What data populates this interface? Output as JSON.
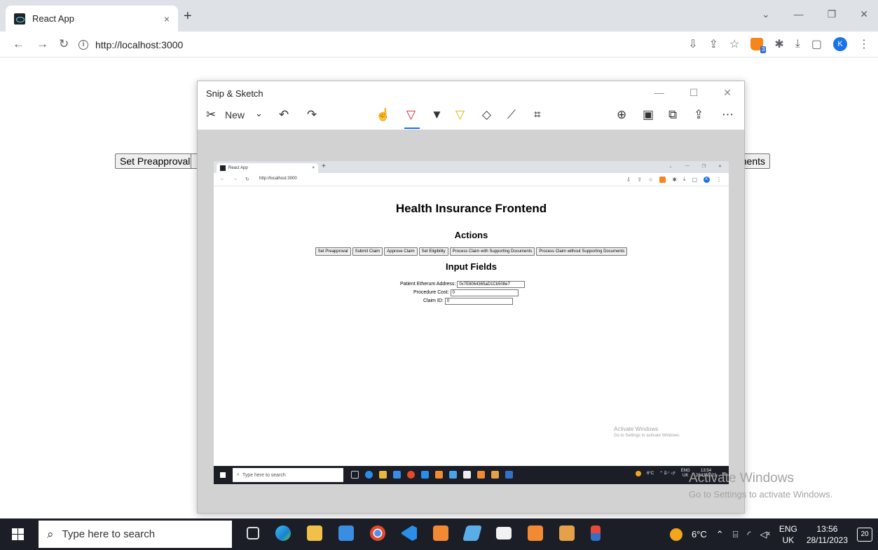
{
  "browser": {
    "tab_title": "React App",
    "tab_close": "×",
    "new_tab": "+",
    "url": "http://localhost:3000",
    "profile_initial": "K",
    "extension_badge": "3"
  },
  "outer_page": {
    "left_button": "Set Preapproval",
    "right_button_fragment": "nents"
  },
  "snip": {
    "title": "Snip & Sketch",
    "new_label": "New"
  },
  "captured": {
    "tab_title": "React App",
    "url": "http://localhost:3000",
    "profile_initial": "K",
    "heading": "Health Insurance Frontend",
    "actions_heading": "Actions",
    "actions": [
      "Set Preapproval",
      "Submit Claim",
      "Approve Claim",
      "Set Eligibility",
      "Process Claim with Supporting Documents",
      "Process Claim without Supporting Documents"
    ],
    "inputs_heading": "Input Fields",
    "fields": [
      {
        "label": "Patient Etherum Address:",
        "value": "0x7E8064365aD1Cb508e7"
      },
      {
        "label": "Procedure Cost:",
        "value": "0"
      },
      {
        "label": "Claim ID:",
        "value": "0"
      }
    ],
    "activate_title": "Activate Windows",
    "activate_sub": "Go to Settings to activate Windows.",
    "search_placeholder": "Type here to search",
    "weather": "6°C",
    "lang1": "ENG",
    "lang2": "UK",
    "time": "13:54",
    "date": "28/11/2023"
  },
  "watermark": {
    "title": "Activate Windows",
    "subtitle": "Go to Settings to activate Windows."
  },
  "taskbar": {
    "search_placeholder": "Type here to search",
    "weather": "6°C",
    "lang1": "ENG",
    "lang2": "UK",
    "time": "13:56",
    "date": "28/11/2023",
    "notifications": "20"
  }
}
